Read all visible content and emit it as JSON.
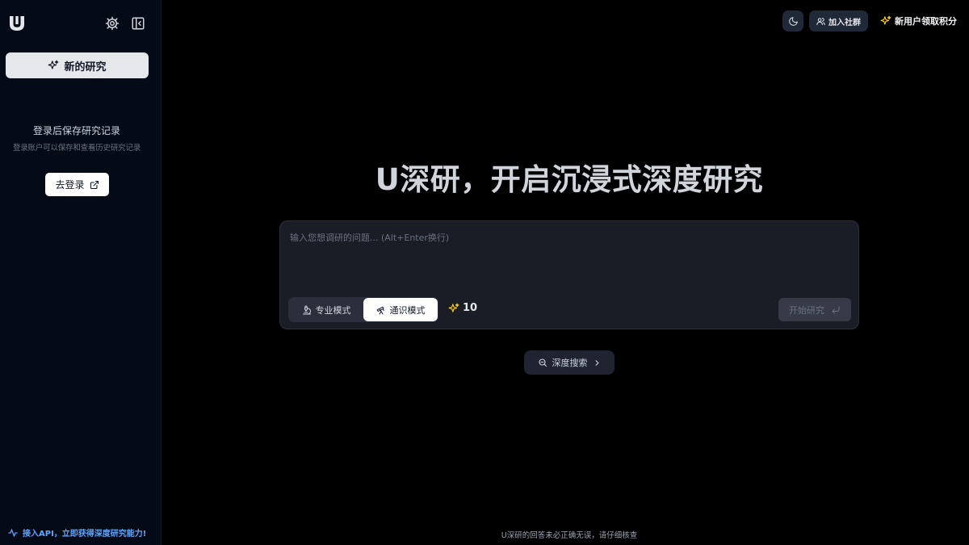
{
  "sidebar": {
    "logo_letter": "U",
    "new_research_label": "新的研究",
    "login_title": "登录后保存研究记录",
    "login_subtitle": "登录账户可以保存和查看历史研究记录",
    "login_button": "去登录",
    "api_link": "接入API，立即获得深度研究能力!"
  },
  "topbar": {
    "community_label": "加入社群",
    "points_label": "新用户领取积分"
  },
  "main": {
    "hero_title": "U深研，开启沉浸式深度研究",
    "input_placeholder": "输入您想调研的问题... (Alt+Enter换行)",
    "input_value": "",
    "modes": [
      {
        "label": "专业模式",
        "active": false
      },
      {
        "label": "通识模式",
        "active": true
      }
    ],
    "credits": "10",
    "start_button": "开始研究",
    "deep_search_label": "深度搜索",
    "disclaimer": "U深研的回答未必正确无误，请仔细核查"
  },
  "colors": {
    "background": "#000000",
    "sidebar_bg": "#050a17",
    "accent_link": "#60a5fa",
    "sparkle": "#facc15"
  }
}
